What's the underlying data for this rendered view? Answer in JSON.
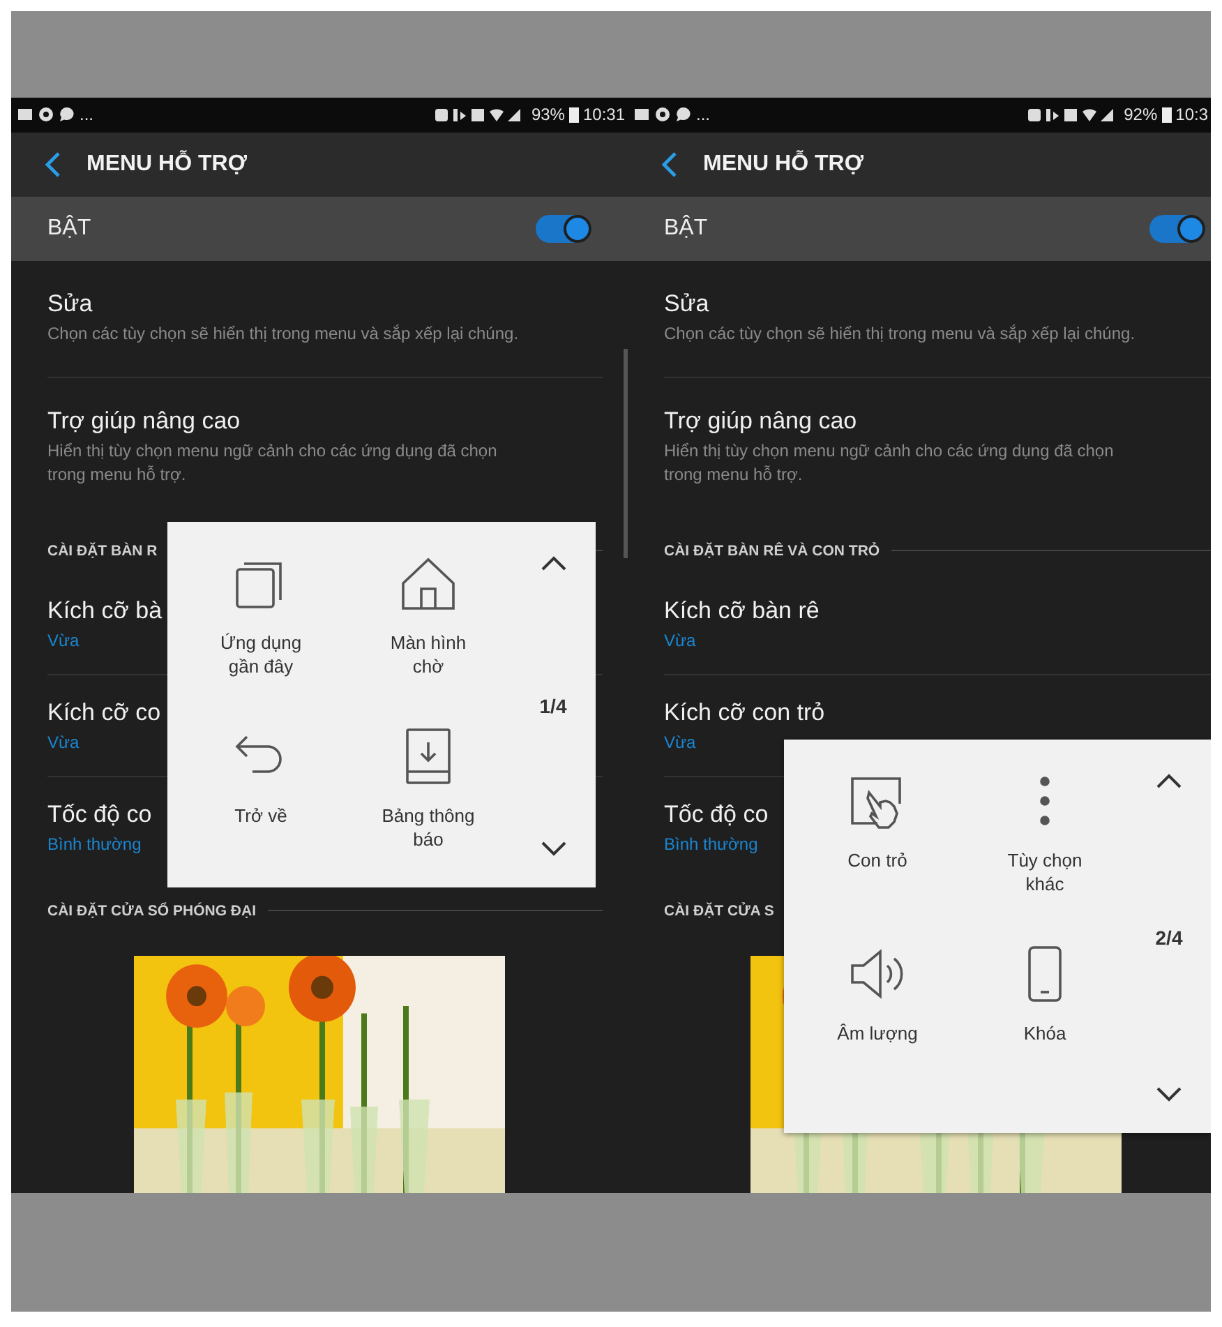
{
  "screens": [
    {
      "status_bar": {
        "more": "...",
        "battery": "93%",
        "time": "10:31"
      },
      "header": {
        "title": "MENU HỖ TRỢ"
      },
      "master_switch": {
        "label": "BẬT",
        "on": true
      },
      "rows": [
        {
          "kind": "setting",
          "title": "Sửa",
          "description": "Chọn các tùy chọn sẽ hiển thị trong menu và sắp xếp lại chúng."
        },
        {
          "kind": "setting",
          "title": "Trợ giúp nâng cao",
          "description": "Hiển thị tùy chọn menu ngữ cảnh cho các ứng dụng đã chọn trong menu hỗ trợ."
        },
        {
          "kind": "section",
          "title": "CÀI ĐẶT BÀN R"
        },
        {
          "kind": "value",
          "title": "Kích cỡ bà",
          "value": "Vừa"
        },
        {
          "kind": "value",
          "title": "Kích cỡ co",
          "value": "Vừa"
        },
        {
          "kind": "value",
          "title": "Tốc độ co",
          "value": "Bình thường"
        },
        {
          "kind": "section",
          "title": "CÀI ĐẶT CỬA SỔ PHÓNG ĐẠI"
        },
        {
          "kind": "picture"
        }
      ],
      "assistant_menu": {
        "page": "1/4",
        "items": [
          {
            "kind": "recent",
            "label": "Ứng dụng gần đây"
          },
          {
            "kind": "home",
            "label": "Màn hình chờ"
          },
          {
            "kind": "back",
            "label": "Trở về"
          },
          {
            "kind": "notification",
            "label": "Bảng thông báo"
          }
        ]
      }
    },
    {
      "status_bar": {
        "more": "...",
        "battery": "92%",
        "time": "10:3"
      },
      "header": {
        "title": "MENU HỖ TRỢ"
      },
      "master_switch": {
        "label": "BẬT",
        "on": true
      },
      "rows": [
        {
          "kind": "setting",
          "title": "Sửa",
          "description": "Chọn các tùy chọn sẽ hiển thị trong menu và sắp xếp lại chúng."
        },
        {
          "kind": "setting",
          "title": "Trợ giúp nâng cao",
          "description": "Hiển thị tùy chọn menu ngữ cảnh cho các ứng dụng đã chọn trong menu hỗ trợ."
        },
        {
          "kind": "section",
          "title": "CÀI ĐẶT BÀN RÊ VÀ CON TRỎ"
        },
        {
          "kind": "value",
          "title": "Kích cỡ bàn rê",
          "value": "Vừa"
        },
        {
          "kind": "value",
          "title": "Kích cỡ con trỏ",
          "value": "Vừa"
        },
        {
          "kind": "value",
          "title": "Tốc độ co",
          "value": "Bình thường"
        },
        {
          "kind": "section",
          "title": "CÀI ĐẶT CỬA S"
        },
        {
          "kind": "picture"
        }
      ],
      "assistant_menu": {
        "page": "2/4",
        "items": [
          {
            "kind": "pointer",
            "label": "Con trỏ"
          },
          {
            "kind": "more",
            "label": "Tùy chọn khác"
          },
          {
            "kind": "volume",
            "label": "Âm lượng"
          },
          {
            "kind": "lock",
            "label": "Khóa"
          }
        ]
      }
    }
  ]
}
